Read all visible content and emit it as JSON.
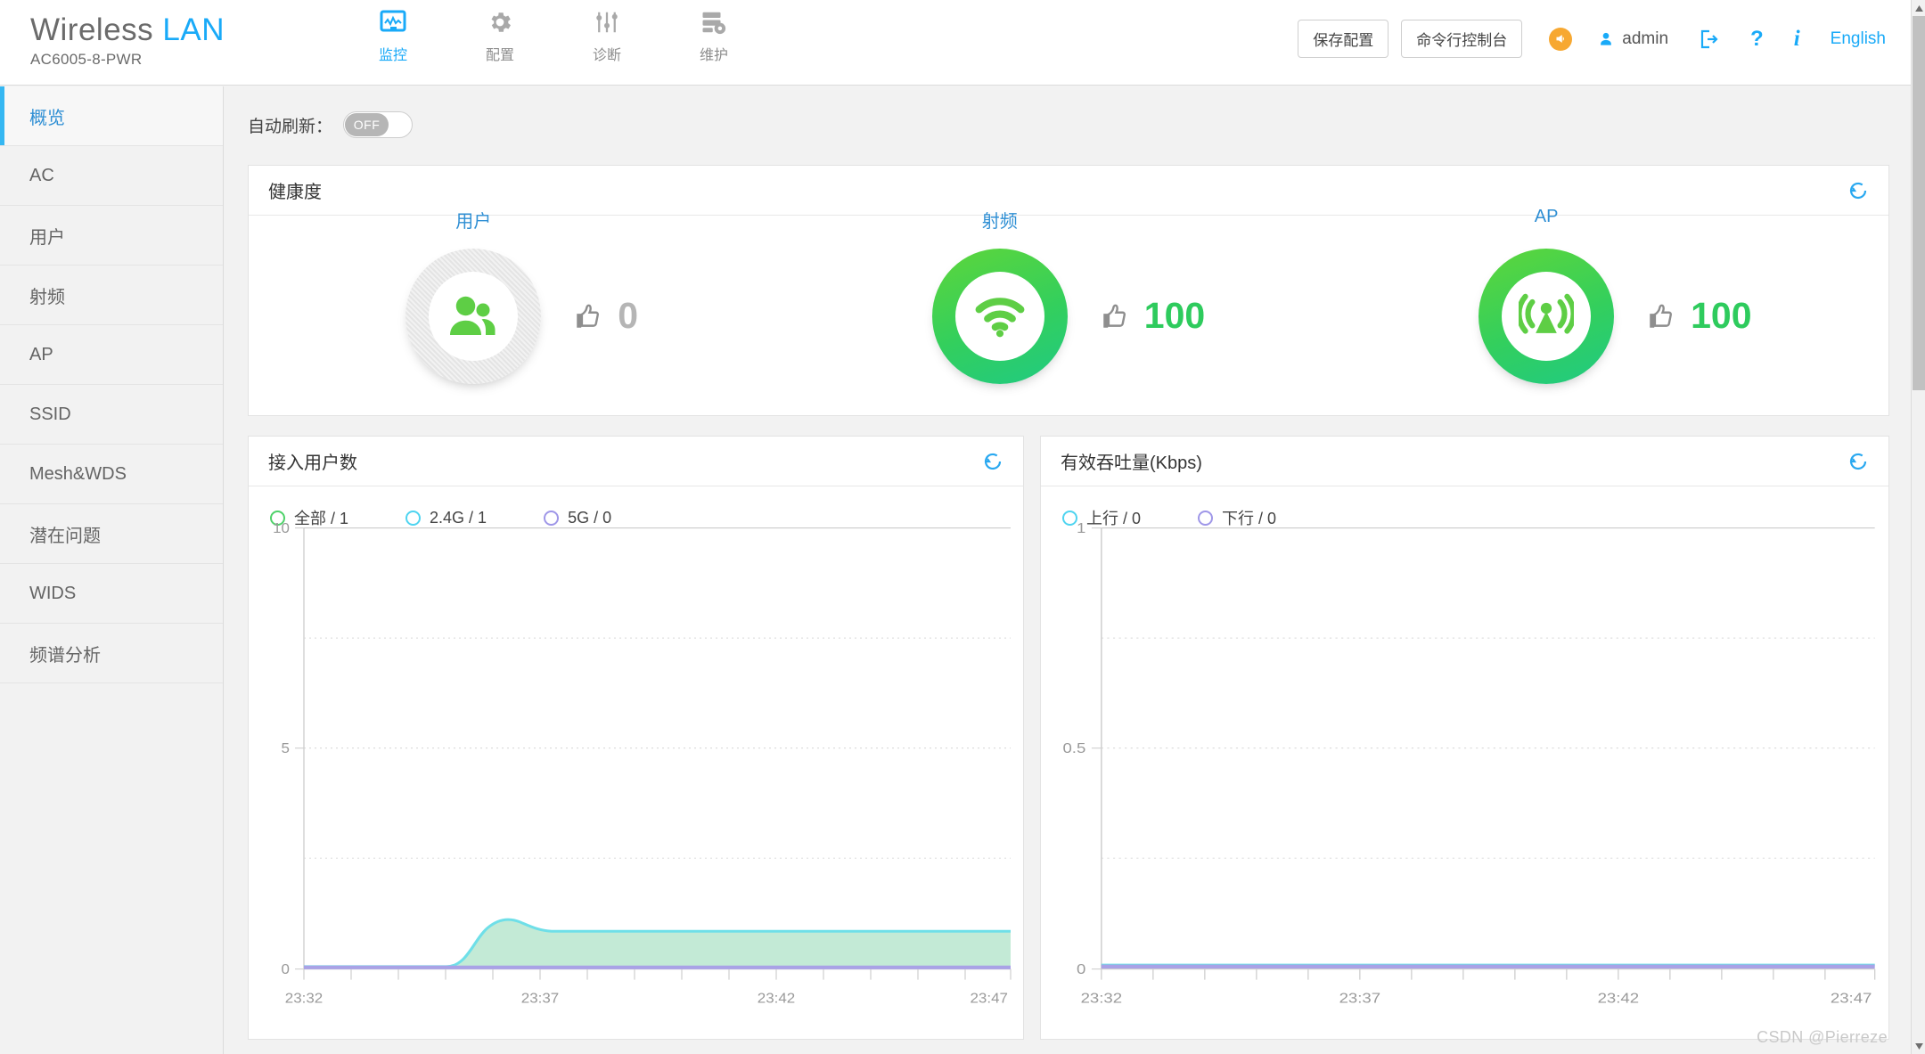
{
  "header": {
    "brand_main": "Wireless",
    "brand_accent": "LAN",
    "model": "AC6005-8-PWR",
    "nav": [
      {
        "label": "监控",
        "icon": "monitor-icon",
        "active": true
      },
      {
        "label": "配置",
        "icon": "gear-icon",
        "active": false
      },
      {
        "label": "诊断",
        "icon": "sliders-icon",
        "active": false
      },
      {
        "label": "维护",
        "icon": "maintenance-icon",
        "active": false
      }
    ],
    "save_config_label": "保存配置",
    "cli_console_label": "命令行控制台",
    "megaphone_icon": "megaphone-icon",
    "user_icon": "user-icon",
    "user_name": "admin",
    "logout_icon": "logout-icon",
    "help_icon": "question-mark-icon",
    "info_icon": "info-icon",
    "language_label": "English",
    "accent_color": "#19aaf8"
  },
  "sidebar": {
    "items": [
      {
        "label": "概览",
        "active": true
      },
      {
        "label": "AC",
        "active": false
      },
      {
        "label": "用户",
        "active": false
      },
      {
        "label": "射频",
        "active": false
      },
      {
        "label": "AP",
        "active": false
      },
      {
        "label": "SSID",
        "active": false
      },
      {
        "label": "Mesh&WDS",
        "active": false
      },
      {
        "label": "潜在问题",
        "active": false
      },
      {
        "label": "WIDS",
        "active": false
      },
      {
        "label": "频谱分析",
        "active": false
      }
    ]
  },
  "toolbar": {
    "auto_refresh_label": "自动刷新：",
    "auto_refresh_state": "OFF"
  },
  "health": {
    "title": "健康度",
    "refresh_icon": "refresh-icon",
    "items": [
      {
        "label": "用户",
        "icon": "users-icon",
        "score": "0",
        "state": "inactive"
      },
      {
        "label": "射频",
        "icon": "wifi-icon",
        "score": "100",
        "state": "good"
      },
      {
        "label": "AP",
        "icon": "ap-antenna-icon",
        "score": "100",
        "state": "good"
      }
    ],
    "thumb_icon": "thumbs-up-icon"
  },
  "chart_data": [
    {
      "type": "area",
      "title": "接入用户数",
      "refresh_icon": "refresh-icon",
      "xlabel": "",
      "ylabel": "",
      "ylim": [
        0,
        10
      ],
      "yticks": [
        0,
        5,
        10
      ],
      "ytick_labels": [
        "0",
        "5",
        "10"
      ],
      "gridlines": [
        2.5,
        5,
        7.5,
        10
      ],
      "grid": true,
      "legend_position": "top-left",
      "x": [
        "23:32",
        "23:37",
        "23:42",
        "23:47"
      ],
      "xtick_labels": [
        "23:32",
        "23:37",
        "23:42",
        "23:47"
      ],
      "series": [
        {
          "name": "全部",
          "legend": "全部 / 1",
          "value": 1,
          "color": "#4fd26a",
          "values": [
            0,
            0,
            0,
            0,
            0,
            0,
            0,
            0,
            0,
            0,
            0.1,
            0.7,
            1.1,
            1.05,
            1,
            1,
            1,
            1,
            1,
            1,
            1,
            1,
            1,
            1,
            1,
            1,
            1,
            1,
            1,
            1,
            1
          ]
        },
        {
          "name": "2.4G",
          "legend": "2.4G / 1",
          "value": 1,
          "color": "#4fd4f0",
          "values": [
            0,
            0,
            0,
            0,
            0,
            0,
            0,
            0,
            0,
            0,
            0.1,
            0.7,
            1.1,
            1.05,
            1,
            1,
            1,
            1,
            1,
            1,
            1,
            1,
            1,
            1,
            1,
            1,
            1,
            1,
            1,
            1,
            1
          ]
        },
        {
          "name": "5G",
          "legend": "5G / 0",
          "value": 0,
          "color": "#9f97e8",
          "values": [
            0,
            0,
            0,
            0,
            0,
            0,
            0,
            0,
            0,
            0,
            0,
            0,
            0,
            0,
            0,
            0,
            0,
            0,
            0,
            0,
            0,
            0,
            0,
            0,
            0,
            0,
            0,
            0,
            0,
            0,
            0
          ]
        }
      ]
    },
    {
      "type": "line",
      "title": "有效吞吐量(Kbps)",
      "refresh_icon": "refresh-icon",
      "xlabel": "",
      "ylabel": "",
      "ylim": [
        0,
        1
      ],
      "yticks": [
        0,
        0.5,
        1
      ],
      "ytick_labels": [
        "0",
        "0.5",
        "1"
      ],
      "gridlines": [
        0.25,
        0.5,
        0.75,
        1
      ],
      "grid": true,
      "legend_position": "top-left",
      "x": [
        "23:32",
        "23:37",
        "23:42",
        "23:47"
      ],
      "xtick_labels": [
        "23:32",
        "23:37",
        "23:42",
        "23:47"
      ],
      "series": [
        {
          "name": "上行",
          "legend": "上行 / 0",
          "value": 0,
          "color": "#4fd4f0",
          "values": [
            0,
            0,
            0,
            0,
            0,
            0,
            0,
            0,
            0,
            0,
            0,
            0,
            0,
            0,
            0,
            0,
            0,
            0,
            0,
            0,
            0,
            0,
            0,
            0,
            0,
            0,
            0,
            0,
            0,
            0,
            0
          ]
        },
        {
          "name": "下行",
          "legend": "下行 / 0",
          "value": 0,
          "color": "#9f97e8",
          "values": [
            0,
            0,
            0,
            0,
            0,
            0,
            0,
            0,
            0,
            0,
            0,
            0,
            0,
            0,
            0,
            0,
            0,
            0,
            0,
            0,
            0,
            0,
            0,
            0,
            0,
            0,
            0,
            0,
            0,
            0,
            0
          ]
        }
      ]
    }
  ],
  "watermark": "CSDN @Pierreze"
}
